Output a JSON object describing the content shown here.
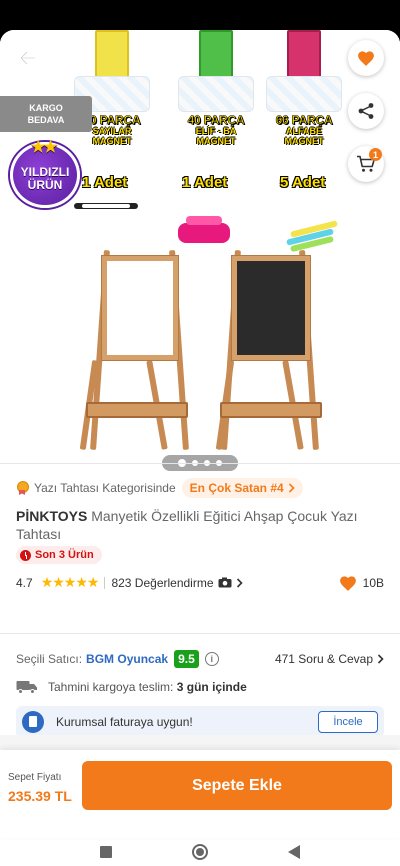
{
  "gallery": {
    "kargo_line1": "KARGO",
    "kargo_line2": "BEDAVA",
    "yildizli_line1": "YILDIZLI",
    "yildizli_line2": "ÜRÜN",
    "cart_count": "1",
    "products": [
      {
        "count": "30",
        "unit": "PARÇA",
        "line1": "SAYILAR",
        "line2": "MAGNET",
        "adet": "1 Adet",
        "box_color": "#f2e24a"
      },
      {
        "count": "40",
        "unit": "PARÇA",
        "line1": "ELİF - BA",
        "line2": "MAGNET",
        "adet": "1 Adet",
        "box_color": "#4fbf4a"
      },
      {
        "count": "66",
        "unit": "PARÇA",
        "line1": "ALFABE",
        "line2": "MAGNET",
        "adet": "5 Adet",
        "box_color": "#d6336c"
      }
    ],
    "page_dots": 4,
    "active_dot": 0
  },
  "category": {
    "text": "Yazı Tahtası Kategorisinde",
    "badge": "En Çok Satan #4"
  },
  "product": {
    "brand": "PİNKTOYS",
    "name": "Manyetik Özellikli Eğitici Ahşap Çocuk Yazı Tahtası",
    "stock_badge": "Son 3 Ürün",
    "rating": "4.7",
    "star_fill_fraction": 0.94,
    "reviews": "823 Değerlendirme",
    "favorites": "10B"
  },
  "seller": {
    "label": "Seçili Satıcı:",
    "name": "BGM Oyuncak",
    "score": "9.5",
    "qa": "471 Soru & Cevap"
  },
  "delivery": {
    "label": "Tahmini kargoya teslim:",
    "value": "3 gün içinde"
  },
  "invoice": {
    "text": "Kurumsal faturaya uygun!",
    "button": "İncele"
  },
  "purchase": {
    "price_label": "Sepet Fiyatı",
    "price": "235.39 TL",
    "add_button": "Sepete Ekle"
  },
  "colors": {
    "accent": "#f27a1a",
    "link": "#2f6ac2",
    "score_green": "#19a11c",
    "danger": "#d21313"
  }
}
